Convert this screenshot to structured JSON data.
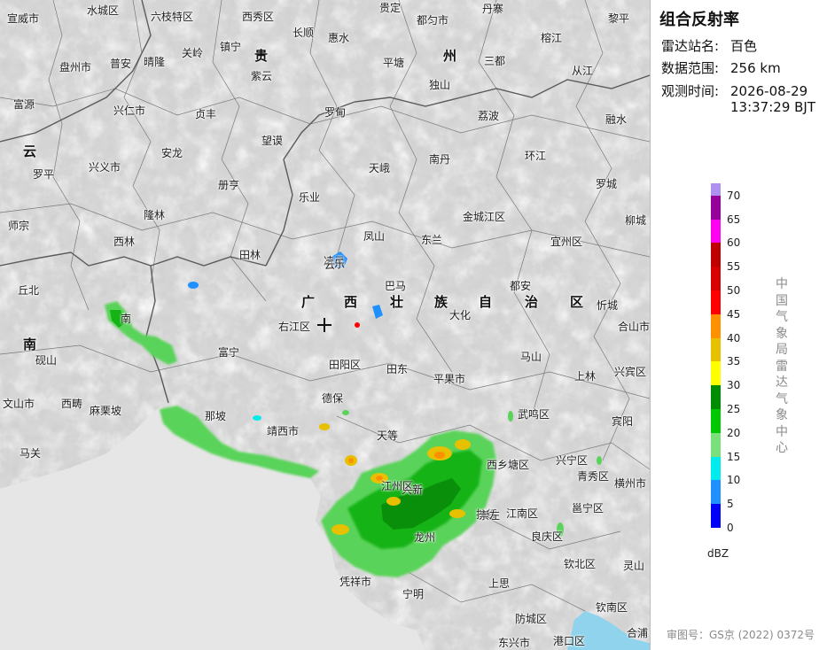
{
  "panel": {
    "title": "组合反射率",
    "station_label": "雷达站名:",
    "station_value": "百色",
    "range_label": "数据范围:",
    "range_value": "256 km",
    "time_label": "观测时间:",
    "time_date": "2026-08-29",
    "time_clock": "13:37:29 BJT",
    "unit": "dBZ",
    "source_chars": [
      "中",
      "国",
      "气",
      "象",
      "局",
      "雷",
      "达",
      "气",
      "象",
      "中",
      "心"
    ],
    "review_no": "审图号：GS京 (2022) 0372号"
  },
  "legend": [
    {
      "label": "",
      "color": "#ad90f0"
    },
    {
      "label": "70",
      "color": "#96009b"
    },
    {
      "label": "65",
      "color": "#ff00f0"
    },
    {
      "label": "60",
      "color": "#c00000"
    },
    {
      "label": "55",
      "color": "#d60000"
    },
    {
      "label": "50",
      "color": "#ff0000"
    },
    {
      "label": "45",
      "color": "#ff9000"
    },
    {
      "label": "40",
      "color": "#e7c000"
    },
    {
      "label": "35",
      "color": "#ffff00"
    },
    {
      "label": "30",
      "color": "#008e00"
    },
    {
      "label": "25",
      "color": "#00c800"
    },
    {
      "label": "20",
      "color": "#7ae07a"
    },
    {
      "label": "15",
      "color": "#00ecec"
    },
    {
      "label": "10",
      "color": "#1e90ff"
    },
    {
      "label": "5",
      "color": "#0000f6"
    },
    {
      "label": "0",
      "color": ""
    }
  ],
  "map": {
    "station_marker": "plus-icon",
    "provinces": [
      "贵",
      "州",
      "云",
      "南",
      "广",
      "西",
      "壮",
      "族",
      "自",
      "治",
      "区"
    ],
    "cities": [
      "宣威市",
      "水城区",
      "六枝特区",
      "西秀区",
      "贵定",
      "都匀市",
      "丹寨",
      "黎平",
      "镇宁",
      "长顺",
      "惠水",
      "榕江",
      "盘州市",
      "普安",
      "晴隆",
      "关岭",
      "紫云",
      "平塘",
      "三都",
      "从江",
      "富源",
      "兴仁市",
      "贞丰",
      "罗甸",
      "独山",
      "荔波",
      "融水",
      "安龙",
      "望谟",
      "南丹",
      "环江",
      "罗平",
      "兴义市",
      "天峨",
      "册亨",
      "罗城",
      "隆林",
      "乐业",
      "金城江区",
      "师宗",
      "凤山",
      "东兰",
      "宜州区",
      "西林",
      "田林",
      "柳城",
      "凌云",
      "巴马",
      "都安",
      "丘北",
      "大化",
      "忻城",
      "右江区",
      "合山市",
      "砚山",
      "田阳区",
      "马山",
      "上林",
      "兴宾区",
      "田东",
      "平果市",
      "德保",
      "文山市",
      "西畴",
      "武鸣区",
      "麻栗坡",
      "那坡",
      "宾阳",
      "靖西市",
      "天等",
      "马关",
      "西乡塘区",
      "兴宁区",
      "青秀区",
      "横州市",
      "江南区",
      "邕宁区",
      "扶绥",
      "良庆区",
      "灵山",
      "钦北区",
      "上思",
      "凭祥市",
      "宁明",
      "钦南区",
      "防城区",
      "东兴市",
      "港口区",
      "合浦",
      "龙州",
      "大新",
      "崇左",
      "江州区",
      "乐",
      "云",
      "富宁",
      "南"
    ]
  }
}
